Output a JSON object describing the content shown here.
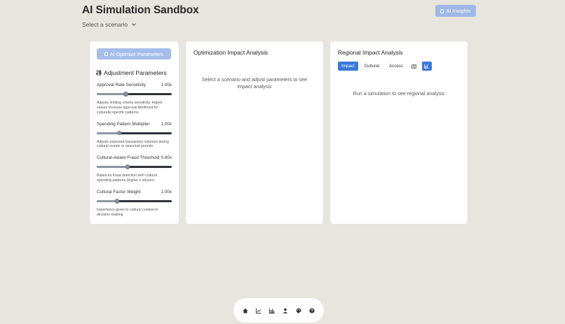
{
  "header": {
    "title": "AI Simulation Sandbox",
    "scenario_placeholder": "Select a scenario",
    "insights_label": "AI Insights"
  },
  "left_panel": {
    "optimize_label": "AI Optimize Parameters",
    "section_title": "Adjustment Parameters",
    "parameters": [
      {
        "label": "Approval Rate Sensitivity",
        "value": "1.00x",
        "level": 0.39,
        "description": "Adjusts lending criteria sensitivity. Higher values increase approval likelihood for culturally-specific patterns"
      },
      {
        "label": "Spending Pattern Multiplier",
        "value": "1.00x",
        "level": 0.3,
        "description": "Adjusts expected transaction volumes during cultural events or seasonal periods"
      },
      {
        "label": "Cultural-Aware Fraud Threshold",
        "value": "0.80x",
        "level": 0.41,
        "description": "Balances fraud detection with cultural spending patterns (higher = stricter)"
      },
      {
        "label": "Cultural Factor Weight",
        "value": "1.00x",
        "level": 0.27,
        "description": "Importance given to cultural context in decision-making"
      }
    ]
  },
  "middle_panel": {
    "title": "Optimization Impact Analysis",
    "message": "Select a scenario and adjust parameters to see impact analysis"
  },
  "right_panel": {
    "title": "Regional Impact Analysis",
    "tabs": [
      "Impact",
      "Cultural",
      "Access"
    ],
    "active_tab": "Impact",
    "view_icons": [
      "map-icon",
      "bar-chart-icon"
    ],
    "active_view": "bar-chart-icon",
    "message": "Run a simulation to see regional analysis"
  },
  "bottom_nav": {
    "icons": [
      "home-icon",
      "line-chart-icon",
      "bar-chart-icon",
      "user-icon",
      "palette-icon",
      "help-icon"
    ]
  },
  "colors": {
    "background": "#e8e4de",
    "accent": "#3a78d8",
    "button_disabled": "#a6bde9"
  }
}
